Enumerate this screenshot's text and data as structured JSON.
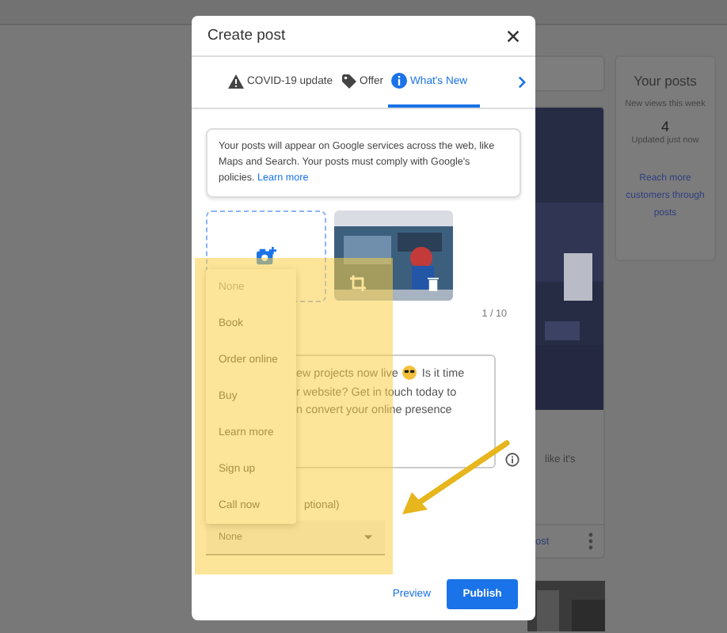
{
  "feed": {
    "snippet": "like it's",
    "action": "ost"
  },
  "your_posts": {
    "title": "Your posts",
    "caption": "New views this week",
    "value": "4",
    "updated": "Updated just now",
    "link": "Reach more customers through posts"
  },
  "modal": {
    "title": "Create post",
    "tabs": [
      {
        "label": "COVID-19 update",
        "selected": false
      },
      {
        "label": "Offer",
        "selected": false
      },
      {
        "label": "What's New",
        "selected": true
      }
    ],
    "notice": {
      "text": "Your posts will appear on Google services across the web, like Maps and Search. Your posts must comply with Google's policies.",
      "link": "Learn more"
    },
    "photo_counter": "1 / 10",
    "description_lines": [
      {
        "parts": [
          "ew projects now live",
          "Is it time"
        ]
      },
      {
        "parts": [
          "r website? Get in touch today to"
        ]
      },
      {
        "parts": [
          "n convert your online presence"
        ]
      }
    ],
    "button_label": "ptional)",
    "button_select": {
      "value": "None"
    },
    "menu": [
      {
        "label": "None",
        "selected": true
      },
      {
        "label": "Book",
        "selected": false
      },
      {
        "label": "Order online",
        "selected": false
      },
      {
        "label": "Buy",
        "selected": false
      },
      {
        "label": "Learn more",
        "selected": false
      },
      {
        "label": "Sign up",
        "selected": false
      },
      {
        "label": "Call now",
        "selected": false
      }
    ],
    "preview": "Preview",
    "publish": "Publish"
  }
}
